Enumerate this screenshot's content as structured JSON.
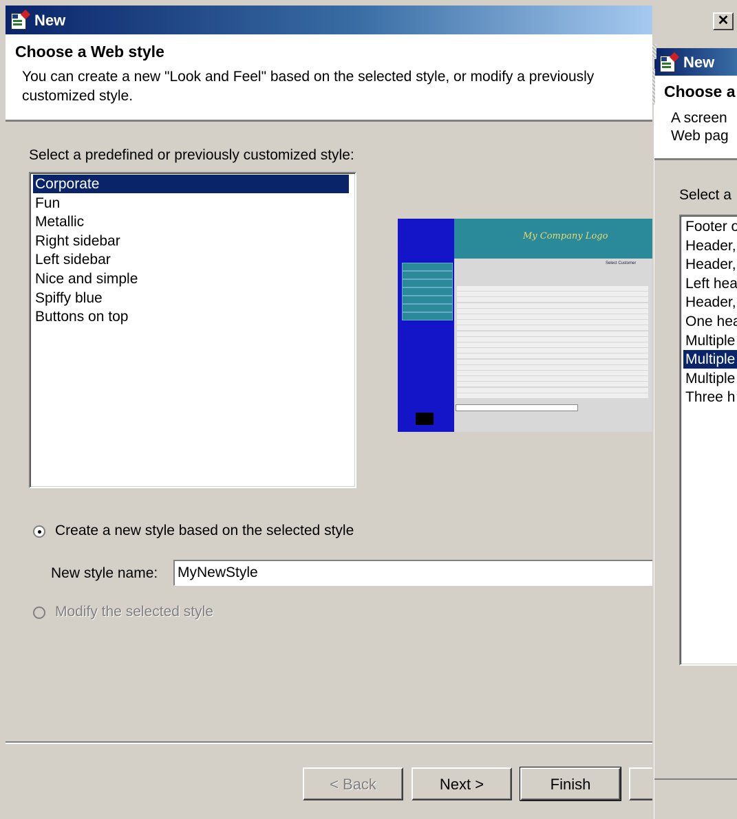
{
  "front_window": {
    "title": "New",
    "heading": "Choose a Web style",
    "description": "You can create a new \"Look and Feel\" based on the selected style, or modify a previously customized style.",
    "list_label": "Select a predefined or previously customized style:",
    "styles": [
      "Corporate",
      "Fun",
      "Metallic",
      "Right sidebar",
      "Left sidebar",
      "Nice and simple",
      "Spiffy blue",
      "Buttons on top"
    ],
    "selected_style": "Corporate",
    "preview": {
      "logo_text": "My Company Logo",
      "select_label": "Select Customer"
    },
    "radio_create_label": "Create a new style based on the selected style",
    "radio_create_checked": true,
    "new_style_label": "New style name:",
    "new_style_value": "MyNewStyle",
    "radio_modify_label": "Modify the selected style",
    "radio_modify_enabled": false,
    "buttons": {
      "back": "< Back",
      "next": "Next >",
      "finish": "Finish"
    }
  },
  "back_window": {
    "title": "New",
    "close_glyph": "✕",
    "heading": "Choose a",
    "desc_line1": "A screen",
    "desc_line2": "Web pag",
    "list_label": "Select a",
    "items": [
      "Footer o",
      "Header,",
      "Header,",
      "Left hea",
      "Header,",
      "One hea",
      "Multiple",
      "Multiple",
      "Multiple",
      "Three h"
    ],
    "selected_index": 7
  },
  "colors": {
    "title_active": "#0a246a",
    "selection": "#0a246a",
    "face": "#d4d0c8"
  }
}
